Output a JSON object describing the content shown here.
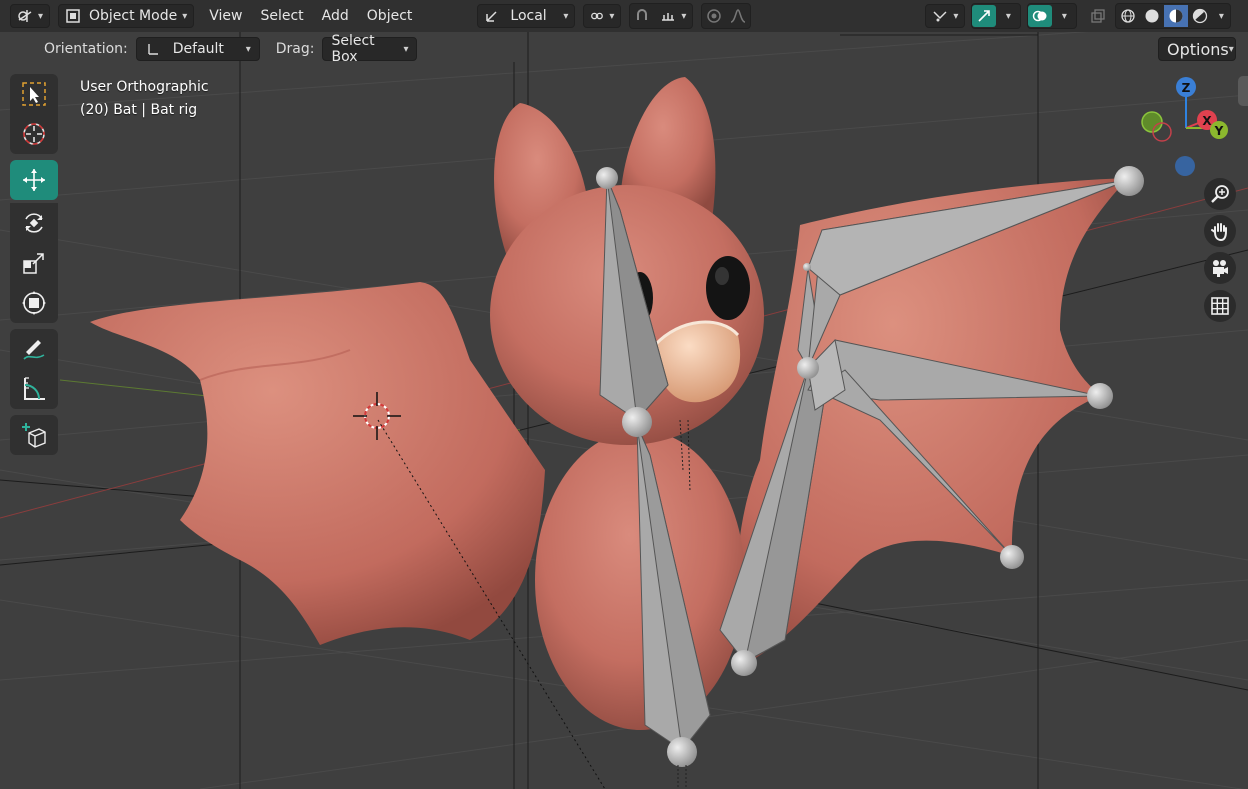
{
  "header": {
    "mode_label": "Object Mode",
    "menus": [
      "View",
      "Select",
      "Add",
      "Object"
    ],
    "transform_space": "Local",
    "icons": [
      "editor-type-icon",
      "object-mode-icon",
      "transform-pivot-icon",
      "snap-icon",
      "snap-increment-icon",
      "proportional-edit-icon",
      "falloff-icon",
      "visibility-icon",
      "gizmo-icon",
      "overlay-icon",
      "xray-icon",
      "shading-wireframe-icon",
      "shading-solid-icon",
      "shading-material-icon",
      "shading-rendered-icon"
    ]
  },
  "tool_settings": {
    "orientation_label": "Orientation:",
    "orientation_value": "Default",
    "drag_label": "Drag:",
    "drag_value": "Select Box",
    "options_label": "Options"
  },
  "viewport": {
    "view_name": "User Orthographic",
    "object_info": "(20) Bat | Bat rig"
  },
  "tools": [
    "select-box-icon",
    "cursor-icon",
    "move-icon",
    "rotate-icon",
    "scale-icon",
    "transform-icon",
    "annotate-icon",
    "measure-icon",
    "add-cube-icon"
  ],
  "gizmo": {
    "x": "X",
    "y": "Y",
    "z": "Z"
  },
  "colors": {
    "accent": "#1f8c7b",
    "bat_skin": "#c66f62",
    "bone": "#a9a9a9",
    "header_bg": "#303030",
    "viewport_bg": "#3f3f3f"
  }
}
